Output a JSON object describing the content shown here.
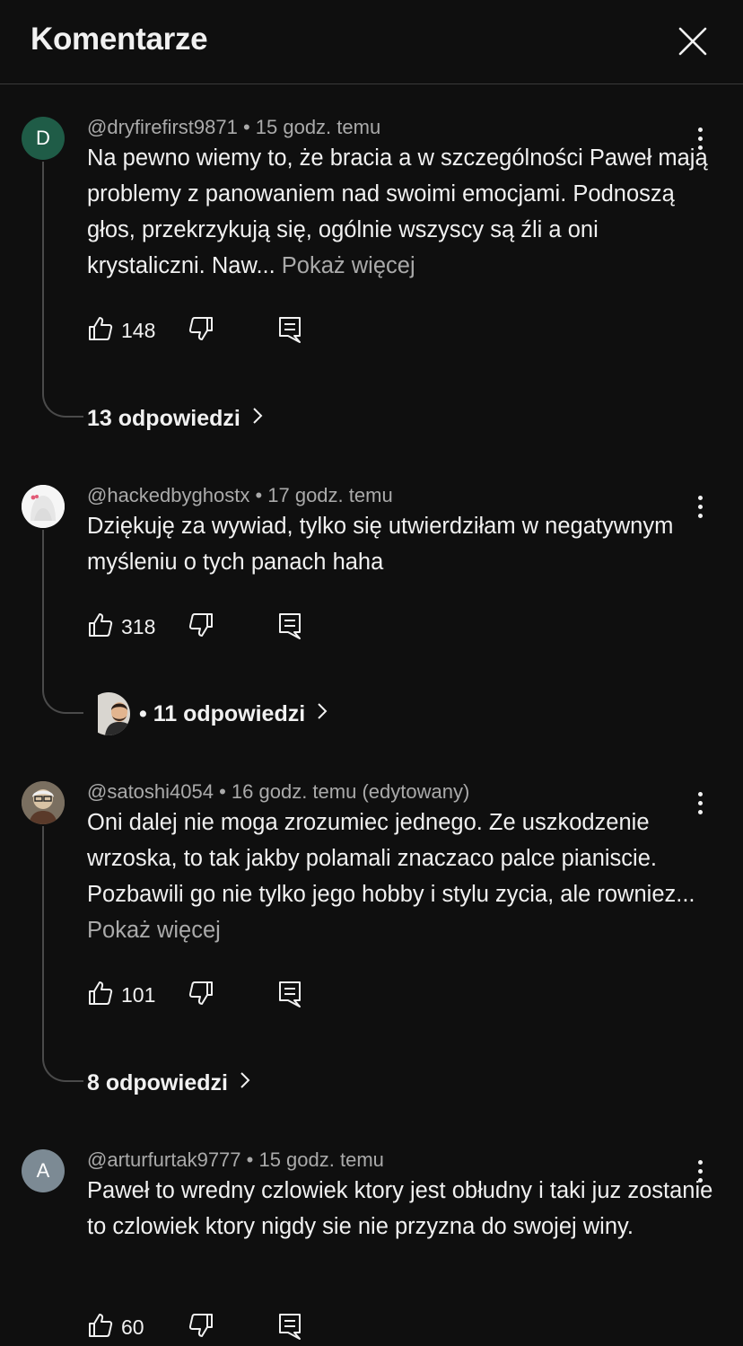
{
  "header": {
    "title": "Komentarze"
  },
  "comments": [
    {
      "avatar_letter": "D",
      "avatar_color": "#1f5c47",
      "meta": "@dryfirefirst9871 • 15 godz. temu",
      "text": "Na pewno wiemy to, że bracia a w szczególności Paweł mają problemy z panowaniem nad swoimi emocjami. Podnoszą głos, przekrzykują się, ogólnie wszyscy są źli a oni krystaliczni. Naw...",
      "show_more": " Pokaż więcej",
      "likes": "148",
      "replies": "13 odpowiedzi"
    },
    {
      "avatar_letter": "",
      "meta": "@hackedbyghostx • 17 godz. temu",
      "text": "Dziękuję za wywiad, tylko się utwierdziłam w negatywnym myśleniu o tych panach haha",
      "likes": "318",
      "replies": "• 11 odpowiedzi"
    },
    {
      "avatar_letter": "",
      "meta": "@satoshi4054 • 16 godz. temu (edytowany)",
      "text": "Oni dalej nie moga zrozumiec jednego. Ze uszkodzenie wrzoska, to tak jakby polamali znaczaco palce pianiscie. Pozbawili go nie tylko jego hobby i stylu zycia, ale rowniez...",
      "show_more": " Pokaż więcej",
      "likes": "101",
      "replies": "8 odpowiedzi"
    },
    {
      "avatar_letter": "A",
      "avatar_color": "#7c8a94",
      "meta": "@arturfurtak9777 • 15 godz. temu",
      "text": "Paweł to wredny czlowiek ktory jest obłudny i taki juz zostanie to czlowiek ktory nigdy sie nie przyzna do swojej winy.",
      "likes": "60"
    }
  ]
}
